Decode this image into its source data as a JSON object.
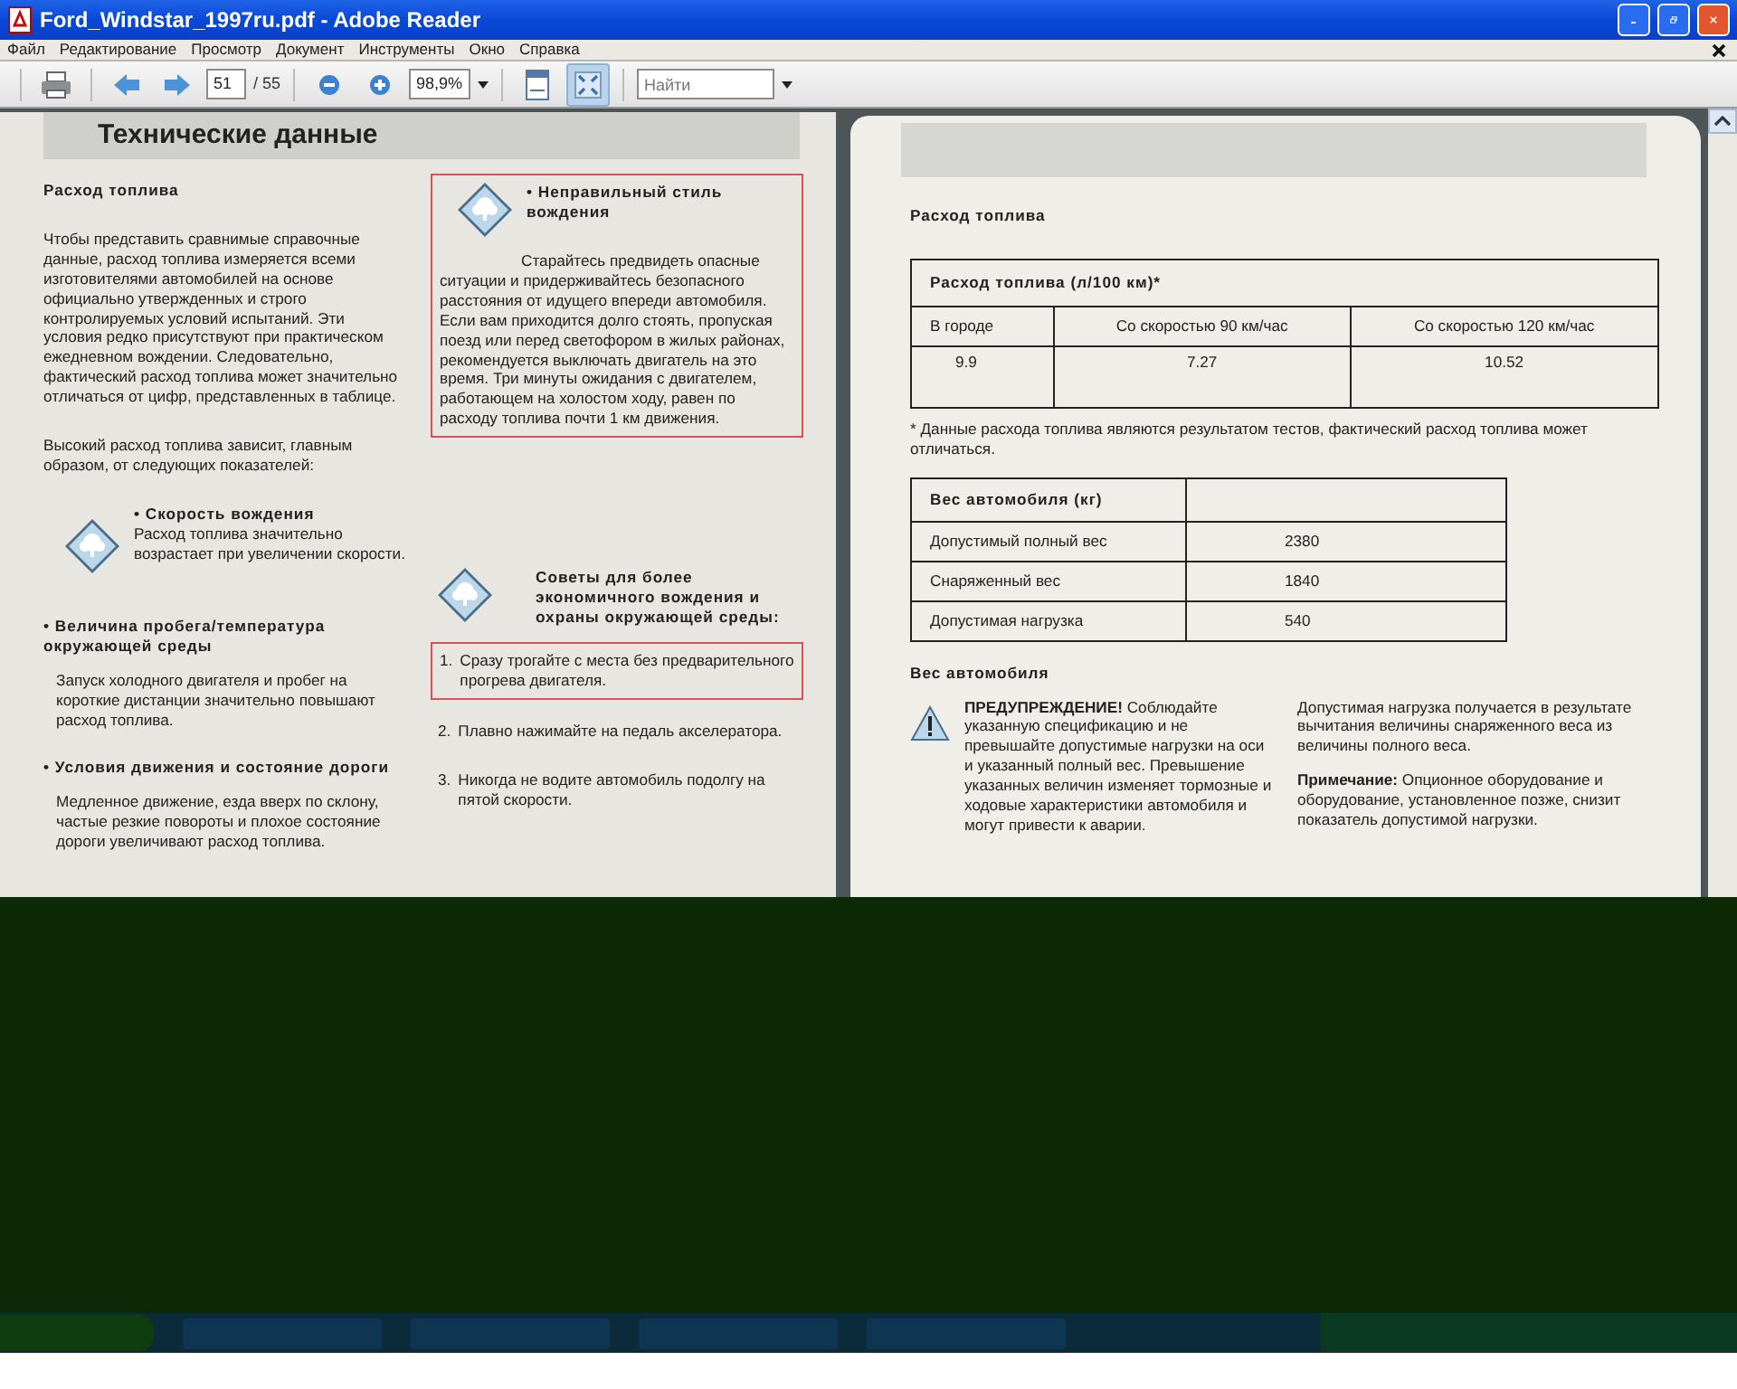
{
  "window": {
    "title": "Ford_Windstar_1997ru.pdf - Adobe Reader"
  },
  "menu": [
    "Файл",
    "Редактирование",
    "Просмотр",
    "Документ",
    "Инструменты",
    "Окно",
    "Справка"
  ],
  "toolbar": {
    "page_current": "51",
    "page_total": "/ 55",
    "zoom": "98,9%",
    "search_placeholder": "Найти",
    "view_buttons": [
      {
        "kind": "fit-width",
        "selected": false
      },
      {
        "kind": "full-window",
        "selected": true
      }
    ]
  },
  "left_page": {
    "heading": "Технические данные",
    "column_1": [
      {
        "kind": "subhead",
        "text": "Расход топлива"
      },
      {
        "kind": "para",
        "text": "Чтобы представить сравнимые справочные данные, расход топлива измеряется всеми изготовителями автомобилей на основе официально утвержденных и строго контролируемых условий испытаний. Эти условия редко присутствуют при практическом ежедневном вождении. Следовательно, фактический расход топлива может значительно отличаться от цифр, представленных в таблице."
      },
      {
        "kind": "para",
        "text": "Высокий расход топлива зависит, главным образом, от следующих показателей:"
      },
      {
        "kind": "icon_item",
        "boxed": false,
        "title": "• Скорость вождения",
        "text": "Расход топлива значительно возрастает при увеличении скорости."
      },
      {
        "kind": "bullet_head",
        "text": "• Величина пробега/температура окружающей среды"
      },
      {
        "kind": "indent_para",
        "text": "Запуск холодного двигателя и пробег на короткие дистанции значительно повышают расход топлива."
      },
      {
        "kind": "bullet_head",
        "text": "• Условия движения и состояние дороги"
      },
      {
        "kind": "indent_para",
        "text": "Медленное движение, езда вверх по склону, частые резкие повороты и плохое состояние дороги увеличивают расход топлива."
      }
    ],
    "column_2": [
      {
        "kind": "icon_item",
        "boxed": true,
        "title": "• Неправильный стиль вождения",
        "text": "Старайтесь предвидеть опасные ситуации и придерживайтесь безопасного расстояния от идущего впереди автомобиля. Если вам приходится долго стоять, пропуская поезд или перед светофором в жилых районах, рекомендуется выключать двигатель на это время. Три минуты ожидания с двигателем, работающем на холостом ходу, равен по расходу топлива почти 1 км движения."
      },
      {
        "kind": "icon_head",
        "text": "Советы для более экономичного вождения и охраны окружающей среды:"
      },
      {
        "kind": "numbered",
        "boxed": true,
        "number": "1.",
        "text": "Сразу трогайте с места без предварительного прогрева двигателя."
      },
      {
        "kind": "numbered",
        "boxed": false,
        "number": "2.",
        "text": "Плавно нажимайте на педаль акселератора."
      },
      {
        "kind": "numbered",
        "boxed": false,
        "number": "3.",
        "text": "Никогда не водите автомобиль подолгу на пятой скорости."
      }
    ]
  },
  "right_page": {
    "subhead": "Расход топлива",
    "consumption_table": {
      "title": "Расход топлива (л/100 км)*",
      "columns": [
        "В городе",
        "Со скоростью 90 км/час",
        "Со скоростью 120 км/час"
      ],
      "values": [
        "9.9",
        "7.27",
        "10.52"
      ]
    },
    "footnote": "* Данные расхода топлива являются результатом тестов, фактический расход топлива может отличаться.",
    "weight_table": {
      "title": "Вес автомобиля (кг)",
      "rows": [
        {
          "label": "Допустимый полный вес",
          "value": "2380"
        },
        {
          "label": "Снаряженный вес",
          "value": "1840"
        },
        {
          "label": "Допустимая нагрузка",
          "value": "540"
        }
      ]
    },
    "weight_subhead": "Вес автомобиля",
    "warning": "**ПРЕДУПРЕЖДЕНИЕ!** Соблюдайте указанную спецификацию и не превышайте допустимые нагрузки на оси и указанный полный вес. Превышение указанных величин изменяет тормозные и ходовые характеристики автомобиля и могут привести к аварии.",
    "notes": [
      "Допустимая нагрузка получается в результате вычитания величины снаряженного веса из величины полного веса.",
      "**Примечание:** Опционное оборудование и оборудование, установленное позже, снизит показатель допустимой нагрузки."
    ]
  }
}
